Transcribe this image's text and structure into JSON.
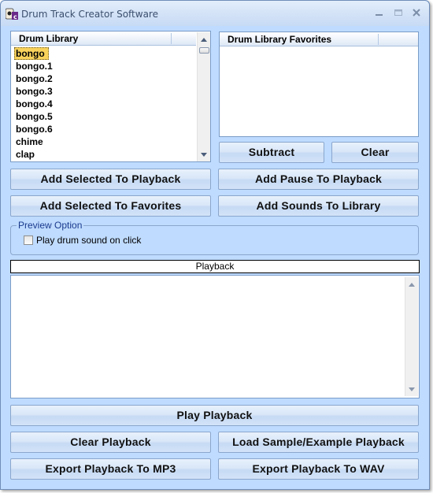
{
  "window": {
    "title": "Drum Track Creator Software",
    "icon": "app-icon",
    "controls": {
      "minimize": "minimize-icon",
      "maximize": "maximize-icon",
      "close": "close-icon"
    }
  },
  "library": {
    "header": "Drum Library",
    "items": [
      "bongo",
      "bongo.1",
      "bongo.2",
      "bongo.3",
      "bongo.4",
      "bongo.5",
      "bongo.6",
      "chime",
      "clap"
    ],
    "selected": "bongo"
  },
  "favorites": {
    "header": "Drum Library Favorites",
    "items": [],
    "subtract_label": "Subtract",
    "clear_label": "Clear"
  },
  "buttons": {
    "add_selected_to_playback": "Add Selected To Playback",
    "add_pause_to_playback": "Add Pause To Playback",
    "add_selected_to_favorites": "Add Selected To Favorites",
    "add_sounds_to_library": "Add Sounds To Library",
    "play_playback": "Play Playback",
    "clear_playback": "Clear Playback",
    "load_sample_playback": "Load Sample/Example Playback",
    "export_mp3": "Export Playback To MP3",
    "export_wav": "Export Playback To WAV"
  },
  "preview": {
    "legend": "Preview Option",
    "checkbox_label": "Play drum sound on click",
    "checked": false
  },
  "playback": {
    "header": "Playback",
    "items": []
  }
}
